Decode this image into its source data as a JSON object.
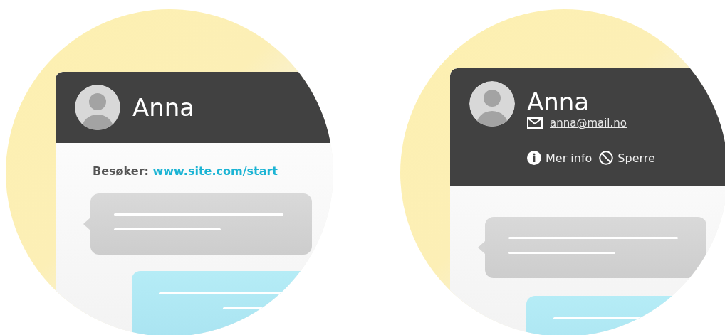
{
  "panels": [
    {
      "contact": {
        "name": "Anna"
      },
      "visitor": {
        "label": "Besøker:",
        "url": "www.site.com/start"
      },
      "messages": [
        {
          "kind": "incoming"
        },
        {
          "kind": "outgoing"
        }
      ]
    },
    {
      "contact": {
        "name": "Anna",
        "email": "anna@mail.no",
        "actions": [
          {
            "kind": "info",
            "label": "Mer info"
          },
          {
            "kind": "block",
            "label": "Sperre"
          }
        ]
      },
      "messages": [
        {
          "kind": "incoming"
        },
        {
          "kind": "outgoing"
        }
      ]
    }
  ]
}
